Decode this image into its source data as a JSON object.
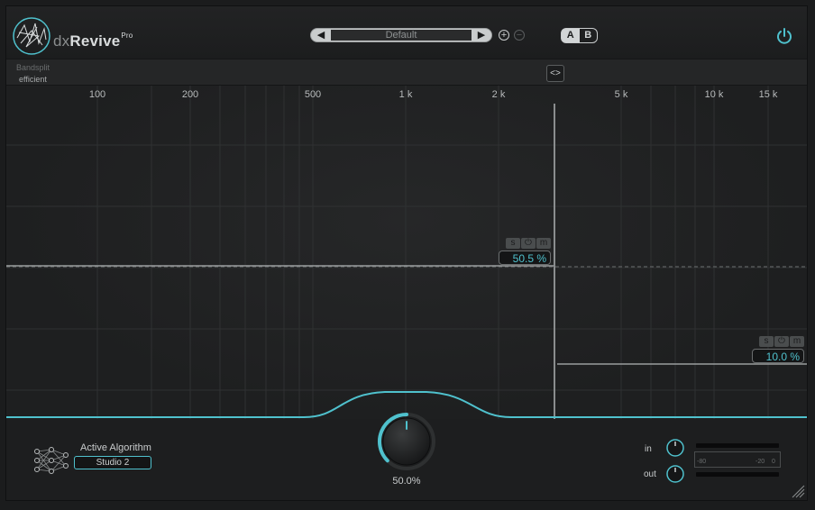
{
  "header": {
    "brand_prefix": "dx",
    "brand_name": "Revive",
    "brand_suffix": "Pro",
    "preset_name": "Default",
    "preset_prev": "◀",
    "preset_next": "▶",
    "add_symbol": "+",
    "remove_symbol": "−",
    "ab_a": "A",
    "ab_b": "B",
    "icons": [
      "logo-icon",
      "power-icon"
    ]
  },
  "subbar": {
    "bandsplit_label": "Bandsplit",
    "bandsplit_value": "efficient",
    "code_button": "<>"
  },
  "graph": {
    "frequency_labels": [
      "100",
      "200",
      "500",
      "1 k",
      "2 k",
      "5 k",
      "10 k",
      "15 k"
    ],
    "crossover_frequency_hz": 3200,
    "bands": [
      {
        "solo": "s",
        "power": "⏻",
        "mute": "m",
        "amount": "50.5 %"
      },
      {
        "solo": "s",
        "power": "⏻",
        "mute": "m",
        "amount": "10.0 %"
      }
    ]
  },
  "bottom": {
    "algo_label": "Active Algorithm",
    "algo_value": "Studio 2",
    "main_knob_value": "50.0%",
    "main_knob_level": 0.5,
    "in_label": "in",
    "out_label": "out",
    "meter_tick_1": "-80",
    "meter_tick_2": "-20",
    "meter_tick_3": "0"
  },
  "colors": {
    "accent": "#4fc1cd",
    "background": "#1e1f20",
    "text": "#c9cccd"
  }
}
